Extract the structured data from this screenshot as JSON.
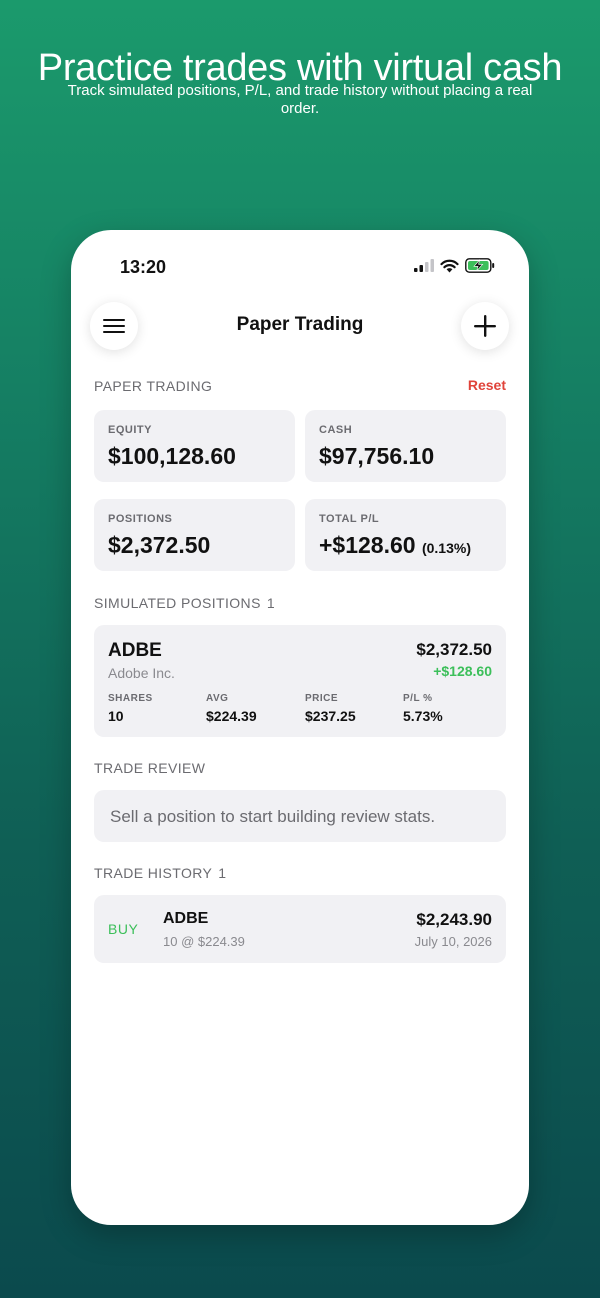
{
  "hero": {
    "title": "Practice trades with virtual cash",
    "subtitle": "Track simulated positions, P/L, and trade history without placing a real order."
  },
  "status_bar": {
    "time": "13:20",
    "icons": [
      "signal-icon",
      "wifi-icon",
      "battery-charging-icon"
    ]
  },
  "nav": {
    "title": "Paper Trading",
    "menu_icon": "menu-icon",
    "add_icon": "plus-icon"
  },
  "summary": {
    "section_label": "PAPER TRADING",
    "reset_label": "Reset",
    "equity": {
      "label": "EQUITY",
      "value": "$100,128.60"
    },
    "cash": {
      "label": "CASH",
      "value": "$97,756.10"
    },
    "positions": {
      "label": "POSITIONS",
      "value": "$2,372.50"
    },
    "total_pl": {
      "label": "TOTAL P/L",
      "value": "+$128.60",
      "percent": "(0.13%)"
    }
  },
  "positions": {
    "section_label": "SIMULATED POSITIONS",
    "count": "1",
    "items": [
      {
        "symbol": "ADBE",
        "name": "Adobe Inc.",
        "market_value": "$2,372.50",
        "gain": "+$128.60",
        "shares_label": "SHARES",
        "shares": "10",
        "avg_label": "AVG",
        "avg": "$224.39",
        "price_label": "PRICE",
        "price": "$237.25",
        "pl_label": "P/L %",
        "pl": "5.73%"
      }
    ]
  },
  "review": {
    "section_label": "TRADE REVIEW",
    "message": "Sell a position to start building review stats."
  },
  "history": {
    "section_label": "TRADE HISTORY",
    "count": "1",
    "items": [
      {
        "side": "BUY",
        "symbol": "ADBE",
        "detail": "10 @ $224.39",
        "amount": "$2,243.90",
        "date": "July 10, 2026"
      }
    ]
  },
  "colors": {
    "accent_green": "#3cbf5a",
    "reset_red": "#e0433a",
    "card_bg": "#f1f1f4",
    "bg_top": "#1b9a6c",
    "bg_bottom": "#0b4a4d"
  }
}
